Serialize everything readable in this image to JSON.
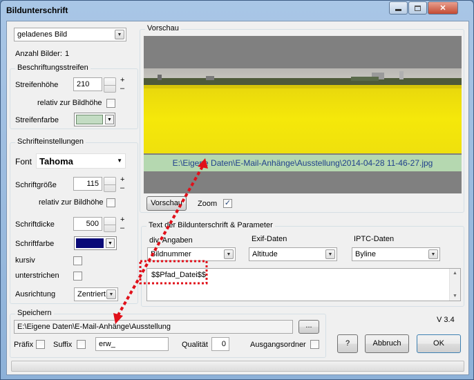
{
  "window": {
    "title": "Bildunterschrift"
  },
  "left": {
    "source_combo": "geladenes Bild",
    "count_label": "Anzahl Bilder:",
    "count_value": "1",
    "stripe_group": "Beschriftungsstreifen",
    "stripe_height_label": "Streifenhöhe",
    "stripe_height_value": "210",
    "relative_height_label": "relativ zur Bildhöhe",
    "stripe_color_label": "Streifenfarbe",
    "font_group": "Schrifteinstellungen",
    "font_label": "Font",
    "font_value": "Tahoma",
    "font_size_label": "Schriftgröße",
    "font_size_value": "115",
    "relative_font_label": "relativ zur Bildhöhe",
    "weight_label": "Schriftdicke",
    "weight_value": "500",
    "font_color_label": "Schriftfarbe",
    "italic_label": "kursiv",
    "underline_label": "unterstrichen",
    "align_label": "Ausrichtung",
    "align_value": "Zentriert",
    "plus": "+",
    "minus": "–"
  },
  "preview": {
    "group": "Vorschau",
    "caption": "E:\\Eigene Daten\\E-Mail-Anhänge\\Ausstellung\\2014-04-28 11-46-27.jpg",
    "preview_button": "Vorschau",
    "zoom_label": "Zoom",
    "zoom_checked": "✓"
  },
  "caption_text": {
    "group": "Text der Bildunterschrift  &  Parameter",
    "col1_label": "div. Angaben",
    "col1_value": "Bildnummer",
    "col2_label": "Exif-Daten",
    "col2_value": "Altitude",
    "col3_label": "IPTC-Daten",
    "col3_value": "Byline",
    "text_value": "$$Pfad_Datei$$"
  },
  "save": {
    "group": "Speichern",
    "path": "E:\\Eigene Daten\\E-Mail-Anhänge\\Ausstellung",
    "browse": "...",
    "prefix_label": "Präfix",
    "suffix_label": "Suffix",
    "name_value": "erw_",
    "quality_label": "Qualität",
    "quality_value": "0",
    "output_folder_label": "Ausgangsordner"
  },
  "footer": {
    "version": "V 3.4",
    "help": "?",
    "cancel": "Abbruch",
    "ok": "OK"
  },
  "colors": {
    "stripe_color": "#c3dcc3",
    "font_color": "#0a0a78",
    "caption_bg": "#b5d8b0",
    "caption_text": "#1f3f8c",
    "annotation": "#e0101a",
    "rapeseed": "#f2e20a"
  },
  "icons": {
    "minimize": "minimize-icon",
    "restore": "restore-icon",
    "close": "close-icon",
    "dropdown": "chevron-down-icon"
  }
}
